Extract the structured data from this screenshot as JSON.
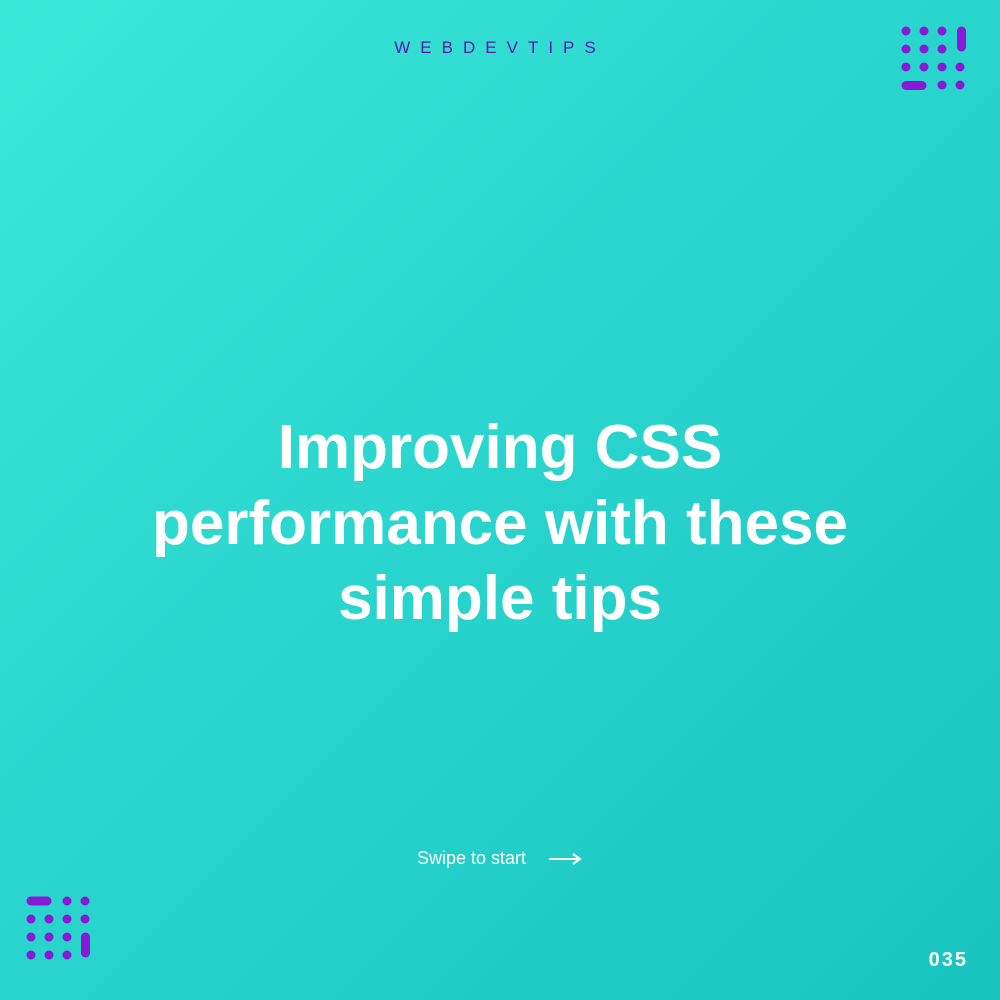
{
  "brand": "WEBDEVTIPS",
  "title": "Improving CSS performance with these simple tips",
  "swipe_label": "Swipe to start",
  "page_number": "035",
  "colors": {
    "accent": "#8A18D8",
    "text": "#ffffff",
    "brand_text": "#5A18A8"
  }
}
